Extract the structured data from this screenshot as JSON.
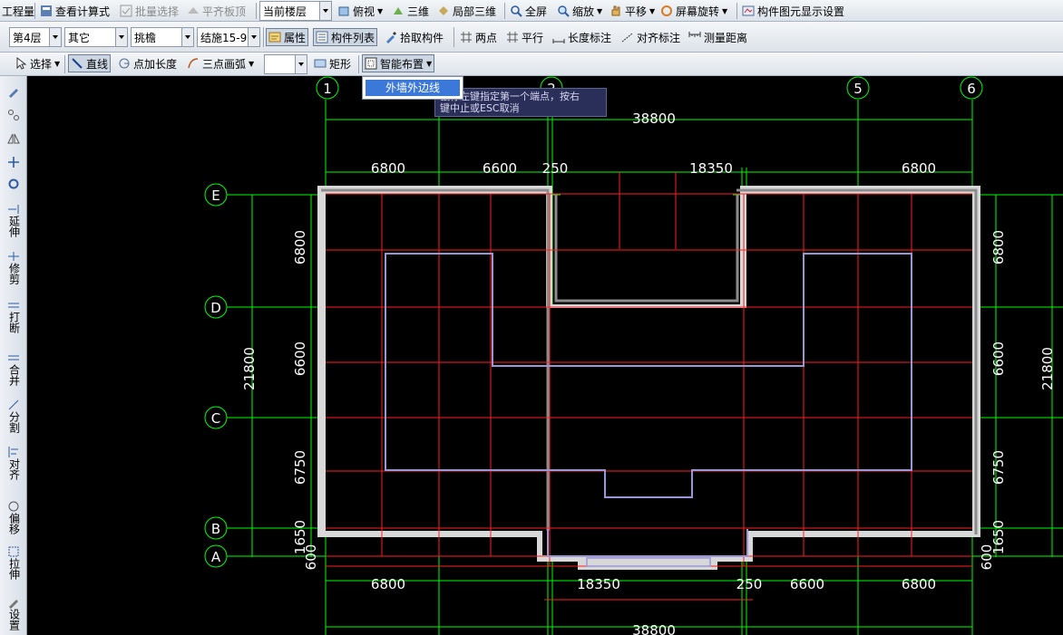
{
  "toolbar_row1": {
    "project": "工程量",
    "view_calc": "查看计算式",
    "batch_select": "批量选择",
    "flush_slab": "平齐板顶",
    "floor_mode": "当前楼层",
    "top_view": "俯视",
    "three_d": "三维",
    "local_3d": "局部三维",
    "full_screen": "全屏",
    "zoom": "缩放",
    "pan": "平移",
    "screen_rotate": "屏幕旋转",
    "display_settings": "构件图元显示设置"
  },
  "toolbar_row2": {
    "floor": "第4层",
    "category": "其它",
    "component_type": "挑檐",
    "component_name": "结施15-9",
    "properties": "属性",
    "component_list": "构件列表",
    "pick_component": "拾取构件",
    "two_points": "两点",
    "parallel": "平行",
    "length_dim": "长度标注",
    "align_dim": "对齐标注",
    "measure_distance": "测量距离"
  },
  "toolbar_row3": {
    "select": "选择",
    "line": "直线",
    "point_length": "点加长度",
    "three_point_arc": "三点画弧",
    "arc_option": "",
    "rectangle": "矩形",
    "smart_layout": "智能布置"
  },
  "dropdown": {
    "item1": "外墙外边线"
  },
  "tooltip": {
    "line1": "鼠标左键指定第一个端点，按右",
    "line2": "键中止或ESC取消"
  },
  "left_toolbar": {
    "extend": "延伸",
    "trim": "修剪",
    "break": "打断",
    "merge": "合并",
    "split": "分割",
    "align": "对齐",
    "offset": "偏移",
    "stretch": "拉伸",
    "settings": "设置"
  },
  "drawing": {
    "axis_labels_top": [
      "1",
      "2",
      "5",
      "6"
    ],
    "axis_labels_left": [
      "E",
      "D",
      "C",
      "B",
      "A"
    ],
    "dim_total_top": "38800",
    "dims_top": [
      "6800",
      "6600",
      "250",
      "18350",
      "6800"
    ],
    "dims_bottom": [
      "6800",
      "18350",
      "250",
      "6600",
      "6800"
    ],
    "dim_total_bottom": "38800",
    "dims_left": [
      "6800",
      "6600",
      "6750",
      "1650",
      "600"
    ],
    "dim_total_left": "21800",
    "dims_right": [
      "6800",
      "6600",
      "6750",
      "1650",
      "600"
    ],
    "dim_total_right": "21800",
    "colors": {
      "axis": "#ff2020",
      "dimension": "#00ff00",
      "wall_outer": "#d8d8d8",
      "wall_inner": "#8c8c8c",
      "room_outline": "#9a96d8",
      "text": "#ffffff"
    }
  }
}
